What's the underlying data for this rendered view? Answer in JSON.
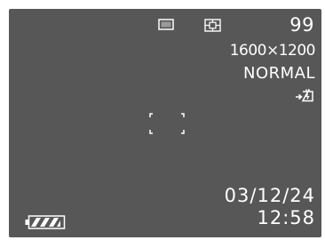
{
  "screen": {
    "background_color": "#575757",
    "text_color": "#ffffff"
  },
  "status": {
    "drive_mode_icon": "single-shot-icon",
    "metering_icon": "multi-pattern-metering-icon",
    "shots_remaining": "99",
    "resolution": "1600×1200",
    "quality": "NORMAL",
    "flash_icon": "flash-icon"
  },
  "focus": {
    "icon": "focus-frame-icon"
  },
  "datetime": {
    "date": "03/12/24",
    "time": "12:58"
  },
  "battery": {
    "icon": "battery-full-icon",
    "level": 1.0
  }
}
